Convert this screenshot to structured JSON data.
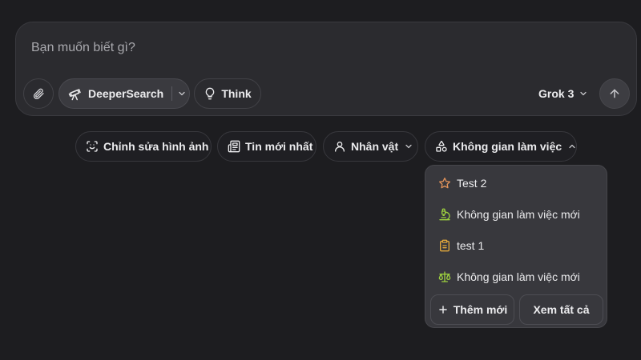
{
  "composer": {
    "placeholder": "Bạn muốn biết gì?",
    "attach_icon": "paperclip-icon",
    "deepsearch_label": "DeeperSearch",
    "deepsearch_icon": "telescope-icon",
    "think_label": "Think",
    "think_icon": "lightbulb-icon",
    "model_label": "Grok 3",
    "send_icon": "arrow-up-icon"
  },
  "chips": [
    {
      "label": "Chỉnh sửa hình ảnh",
      "icon": "image-edit-icon"
    },
    {
      "label": "Tin mới nhất",
      "icon": "newspaper-icon"
    },
    {
      "label": "Nhân vật",
      "icon": "person-icon"
    },
    {
      "label": "Không gian làm việc",
      "icon": "shapes-icon"
    }
  ],
  "workspace_menu": {
    "items": [
      {
        "label": "Test 2",
        "icon": "star-icon",
        "color": "#e0925a"
      },
      {
        "label": "Không gian làm việc mới",
        "icon": "microscope-icon",
        "color": "#9ccf3f"
      },
      {
        "label": "test 1",
        "icon": "clipboard-icon",
        "color": "#e2a83c"
      },
      {
        "label": "Không gian làm việc mới",
        "icon": "scale-icon",
        "color": "#9ccf3f"
      }
    ],
    "add_label": "Thêm mới",
    "view_all_label": "Xem tất cả"
  },
  "colors": {
    "background": "#1d1d20",
    "composer": "#2b2b2f",
    "dropdown": "#38383d",
    "text": "#ececee"
  }
}
